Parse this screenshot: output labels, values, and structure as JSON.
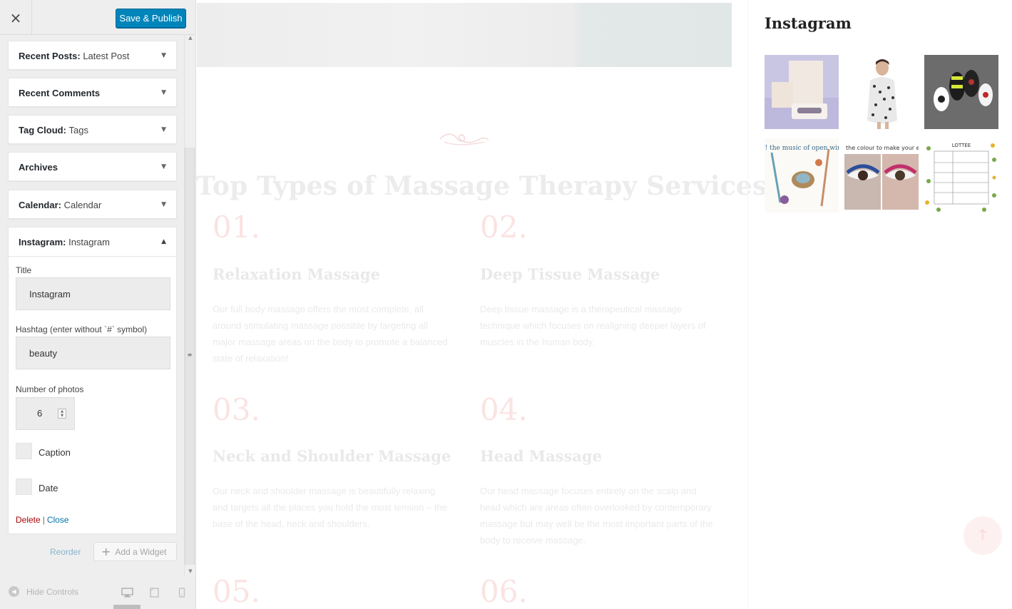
{
  "toolbar": {
    "close_label": "×",
    "publish_label": "Save & Publish"
  },
  "widgets": [
    {
      "name": "Recent Posts",
      "sub": "Latest Post"
    },
    {
      "name": "Recent Comments",
      "sub": ""
    },
    {
      "name": "Tag Cloud",
      "sub": "Tags"
    },
    {
      "name": "Archives",
      "sub": ""
    },
    {
      "name": "Calendar",
      "sub": "Calendar"
    }
  ],
  "open_widget": {
    "name": "Instagram",
    "sub": "Instagram",
    "title_label": "Title",
    "title_value": "Instagram",
    "hashtag_label": "Hashtag (enter without `#` symbol)",
    "hashtag_value": "beauty",
    "photos_label": "Number of photos",
    "photos_value": "6",
    "caption_label": "Caption",
    "date_label": "Date",
    "delete_label": "Delete",
    "separator": "|",
    "close_label": "Close"
  },
  "footer_actions": {
    "reorder_label": "Reorder",
    "add_widget_label": "Add a Widget",
    "hide_controls_label": "Hide Controls"
  },
  "preview": {
    "main_title": "Top Types of Massage Therapy Services",
    "services": [
      {
        "num": "01.",
        "title": "Relaxation Massage",
        "desc": "Our full body massage offers the most complete, all around stimulating massage possible by targeting all major massage areas on the body to promote a balanced state of relaxation!"
      },
      {
        "num": "02.",
        "title": "Deep Tissue Massage",
        "desc": "Deep tissue massage is a therapeutical massage technique which focuses on realigning deeper layers of muscles in the human body."
      },
      {
        "num": "03.",
        "title": "Neck and Shoulder Massage",
        "desc": "Our neck and shoulder massage is beautifully relaxing and targets all the places you hold the most tension – the base of the head, neck and shoulders."
      },
      {
        "num": "04.",
        "title": "Head Massage",
        "desc": "Our head massage focuses entirely on the scalp and head which are areas often overlooked by contemporary massage but may well be the most important parts of the body to receive massage."
      },
      {
        "num": "05.",
        "title": "",
        "desc": ""
      },
      {
        "num": "06.",
        "title": "",
        "desc": ""
      }
    ],
    "instagram_title": "Instagram",
    "photo_captions": [
      "",
      "",
      "",
      "Spring! the music of open windows.",
      "the colour to make your eyes p",
      "LOTTEE"
    ]
  },
  "colors": {
    "publish_bg": "#0085ba",
    "delete": "#aa0000",
    "link": "#0073aa",
    "service_number": "#fbe3e3"
  }
}
